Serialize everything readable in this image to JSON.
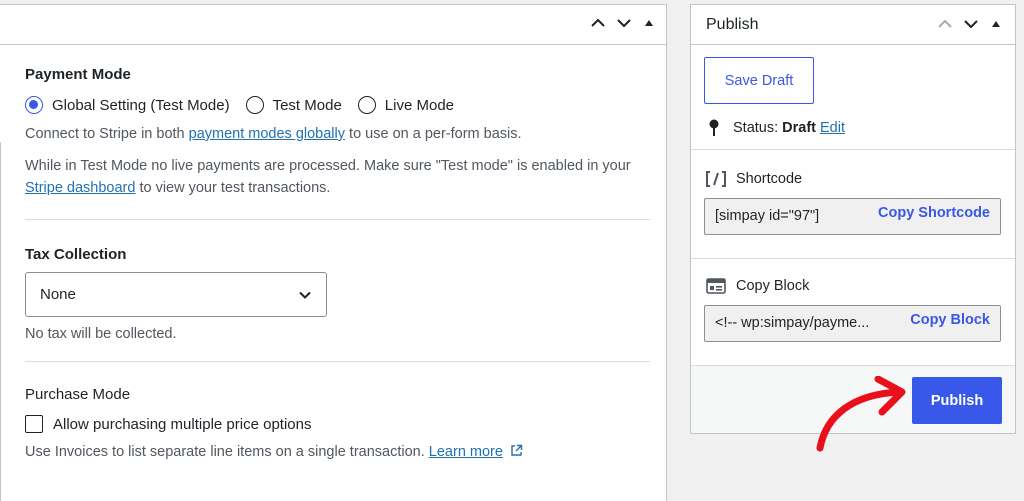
{
  "main": {
    "payment_mode": {
      "title": "Payment Mode",
      "options": [
        "Global Setting (Test Mode)",
        "Test Mode",
        "Live Mode"
      ],
      "selected": "Global Setting (Test Mode)",
      "connect_pre": "Connect to Stripe in both ",
      "connect_link": "payment modes globally",
      "connect_post": " to use on a per-form basis.",
      "test_note_pre": "While in Test Mode no live payments are processed. Make sure \"Test mode\" is enabled in your ",
      "test_note_link": "Stripe dashboard",
      "test_note_post": " to view your test transactions."
    },
    "tax": {
      "title": "Tax Collection",
      "selected": "None",
      "help": "No tax will be collected."
    },
    "purchase_mode": {
      "title": "Purchase Mode",
      "checkbox_label": "Allow purchasing multiple price options",
      "help_pre": "Use Invoices to list separate line items on a single transaction. ",
      "help_link": "Learn more"
    }
  },
  "publish": {
    "title": "Publish",
    "save_draft": "Save Draft",
    "status_label": "Status:",
    "status_value": "Draft",
    "status_edit": "Edit",
    "shortcode_label": "Shortcode",
    "shortcode_value": "[simpay id=\"97\"]",
    "shortcode_copy": "Copy Shortcode",
    "block_label": "Copy Block",
    "block_value": "<!-- wp:simpay/payme...",
    "block_copy": "Copy Block",
    "publish_button": "Publish"
  },
  "colors": {
    "accent": "#3858e9",
    "link": "#2271b1",
    "annotation_arrow": "#e8101a"
  }
}
